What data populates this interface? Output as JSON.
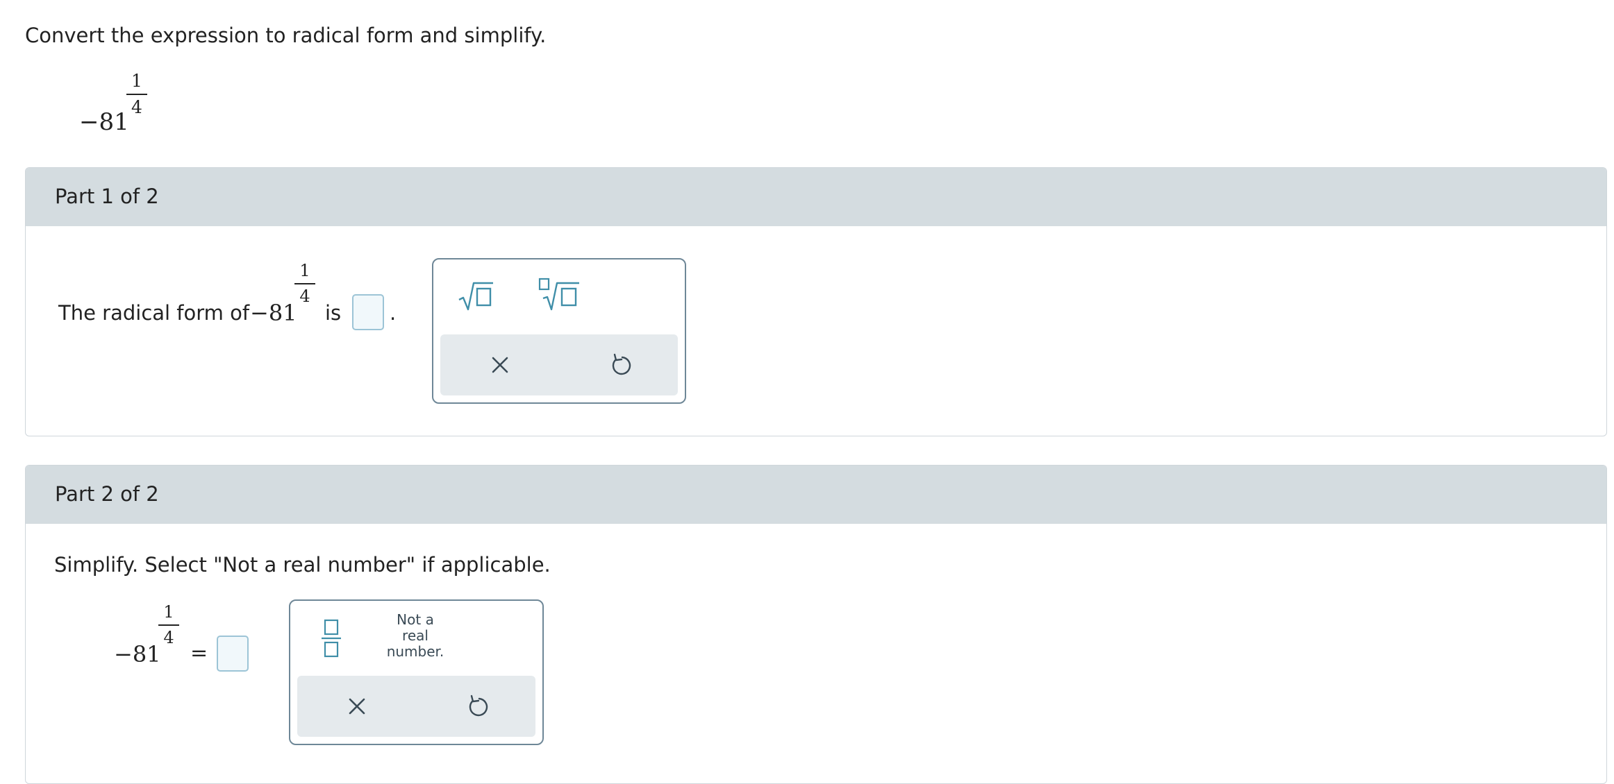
{
  "prompt": "Convert the expression to radical form and simplify.",
  "expression": {
    "base": "−81",
    "exp_numerator": "1",
    "exp_denominator": "4"
  },
  "part1": {
    "header": "Part 1 of 2",
    "sentence_before": "The radical form of",
    "sentence_is": "is",
    "sentence_period": ".",
    "palette": {
      "buttons": [
        "square-root-template",
        "nth-root-template"
      ],
      "actions": [
        "clear",
        "undo"
      ]
    }
  },
  "part2": {
    "header": "Part 2 of 2",
    "instruction": "Simplify. Select \"Not a real number\" if applicable.",
    "equals": "=",
    "palette": {
      "buttons": [
        "fraction-template",
        "not-a-real-number"
      ],
      "not_real_label_line1": "Not a",
      "not_real_label_line2": "real",
      "not_real_label_line3": "number.",
      "actions": [
        "clear",
        "undo"
      ]
    }
  },
  "colors": {
    "header_bg": "#d4dce0",
    "answer_box_border": "#9cc4d6",
    "answer_box_bg": "#f1f8fb",
    "icon_teal": "#3f8ea8",
    "palette_border": "#6e8797",
    "actions_bg": "#e5eaed"
  }
}
